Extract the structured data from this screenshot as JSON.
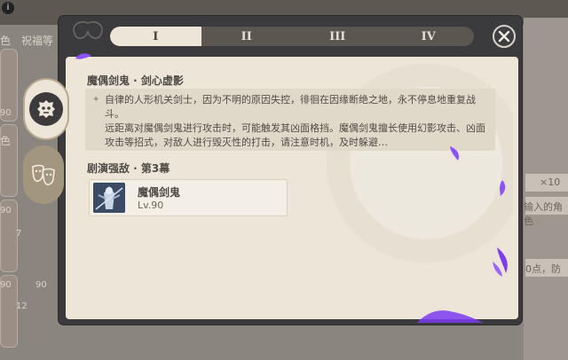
{
  "background": {
    "left_labels": [
      "色",
      "祝福等",
      "色",
      "90",
      "90",
      "90",
      "90"
    ],
    "left_numbers": [
      "7",
      "12"
    ],
    "right_texts": [
      "×10",
      "输入的角色",
      "0点，防"
    ]
  },
  "tabs": [
    "I",
    "II",
    "III",
    "IV"
  ],
  "active_tab": "I",
  "colors": {
    "frame": "#3b3a3d",
    "parchment": "#ece5d8",
    "tab_active": "#ece5d8",
    "tab_inactive": "#5b5650",
    "accent_purple": "#8c52ff"
  },
  "detail": {
    "title": "魔偶剑鬼 · 剑心虚影",
    "description": [
      "自律的人形机关剑士，因为不明的原因失控，徘徊在因缘断绝之地，永不停息地重复战斗。",
      "远距离对魔偶剑鬼进行攻击时，可能触发其凶面格挡。魔偶剑鬼擅长使用幻影攻击、凶面攻击等招式，对敌人进行毁灭性的打击，请注意时机，及时躲避…"
    ],
    "section_title": "剧演强敌 · 第3幕",
    "enemy": {
      "name": "魔偶剑鬼",
      "level": "Lv.90"
    }
  },
  "icons": {
    "close": "close-icon",
    "side_one": "enemy-mask-icon",
    "side_two": "theater-masks-icon",
    "boss": "boss-portrait-icon"
  }
}
